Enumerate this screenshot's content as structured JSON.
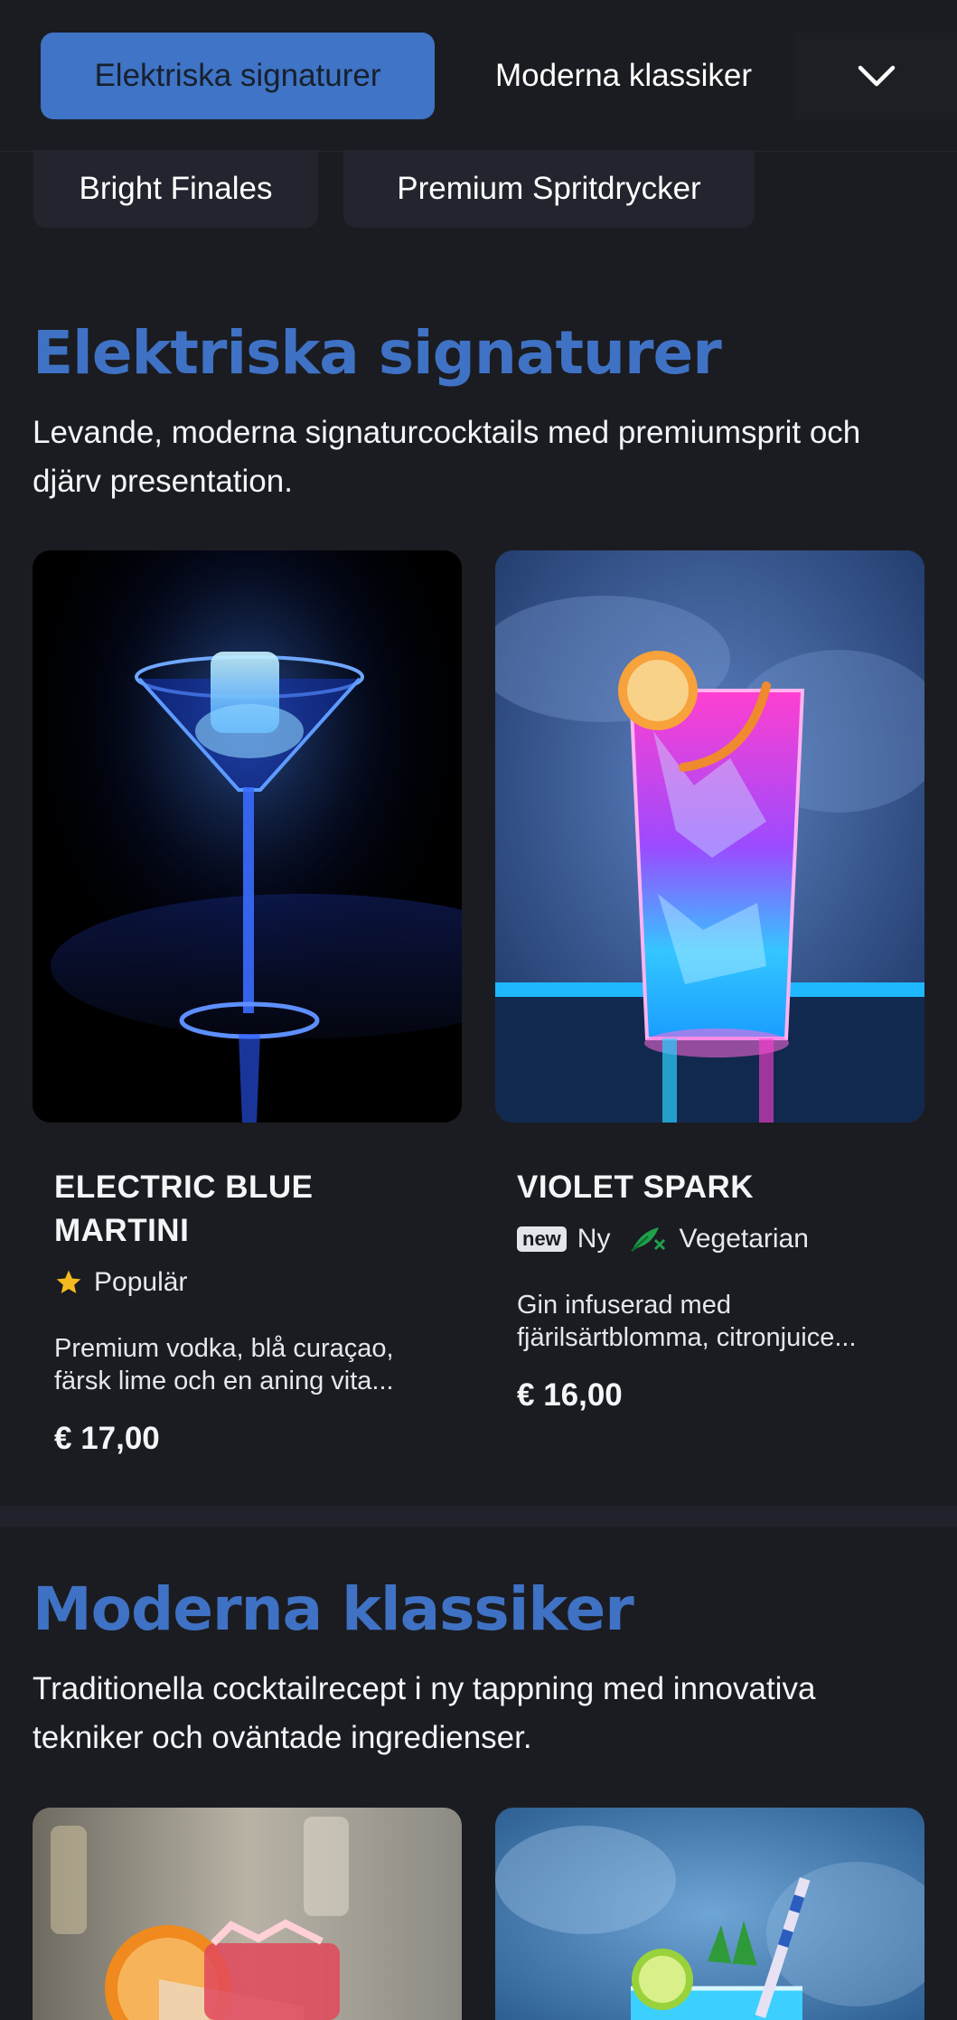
{
  "nav": {
    "tabs": [
      {
        "label": "Elektriska signaturer",
        "active": true
      },
      {
        "label": "Moderna klassiker",
        "active": false
      }
    ],
    "chips": [
      {
        "label": "Bright Finales"
      },
      {
        "label": "Premium Spritdrycker"
      }
    ],
    "dropdown_icon": "chevron-down-icon"
  },
  "sections": [
    {
      "title": "Elektriska signaturer",
      "description": "Levande, moderna signaturcocktails med premiumsprit och djärv presentation.",
      "items": [
        {
          "name_line1": "ELECTRIC BLUE",
          "name_line2": "MARTINI",
          "badges": [
            {
              "icon": "star-icon",
              "label": "Populär"
            }
          ],
          "description_line1": "Premium vodka, blå curaçao,",
          "description_line2": "färsk lime och en aning vita...",
          "price": "€ 17,00"
        },
        {
          "name_line1": "VIOLET SPARK",
          "badges": [
            {
              "icon": "new-tag-icon",
              "tag": "new",
              "label": "Ny"
            },
            {
              "icon": "leaf-icon",
              "label": "Vegetarian"
            }
          ],
          "description_line1": "Gin infuserad med",
          "description_line2": "fjärilsärtblomma, citronjuice...",
          "price": "€ 16,00"
        }
      ]
    },
    {
      "title": "Moderna klassiker",
      "description": "Traditionella cocktailrecept i ny tappning med innovativa tekniker och oväntade ingredienser."
    }
  ],
  "colors": {
    "background": "#1b1c21",
    "accent": "#3f74c6",
    "heading": "#3f72c4",
    "chip": "#22252d",
    "star": "#f5b921",
    "leaf": "#1fa04a"
  }
}
